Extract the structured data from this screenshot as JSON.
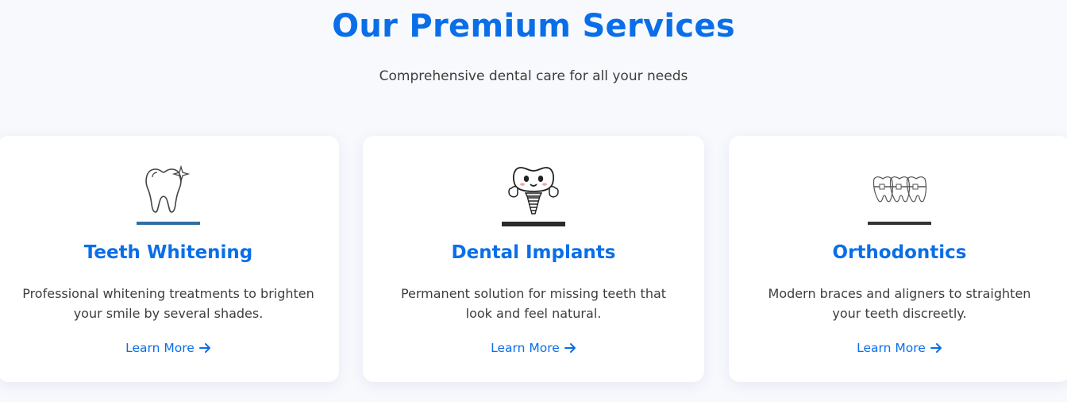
{
  "section": {
    "title": "Our Premium Services",
    "subtitle": "Comprehensive dental care for all your needs"
  },
  "cards": [
    {
      "image_icon": "tooth-sparkle-icon",
      "title": "Teeth Whitening",
      "description": "Professional whitening treatments to brighten your smile by several shades.",
      "link_label": "Learn More",
      "link_icon": "arrow-right-icon"
    },
    {
      "image_icon": "tooth-implant-mascot-icon",
      "title": "Dental Implants",
      "description": "Permanent solution for missing teeth that look and feel natural.",
      "link_label": "Learn More",
      "link_icon": "arrow-right-icon"
    },
    {
      "image_icon": "teeth-braces-icon",
      "title": "Orthodontics",
      "description": "Modern braces and aligners to straighten your teeth discreetly.",
      "link_label": "Learn More",
      "link_icon": "arrow-right-icon"
    }
  ],
  "colors": {
    "accent": "#0a6ee8",
    "text": "#3d3d3d",
    "background": "#f7f9fd",
    "card": "#ffffff"
  }
}
